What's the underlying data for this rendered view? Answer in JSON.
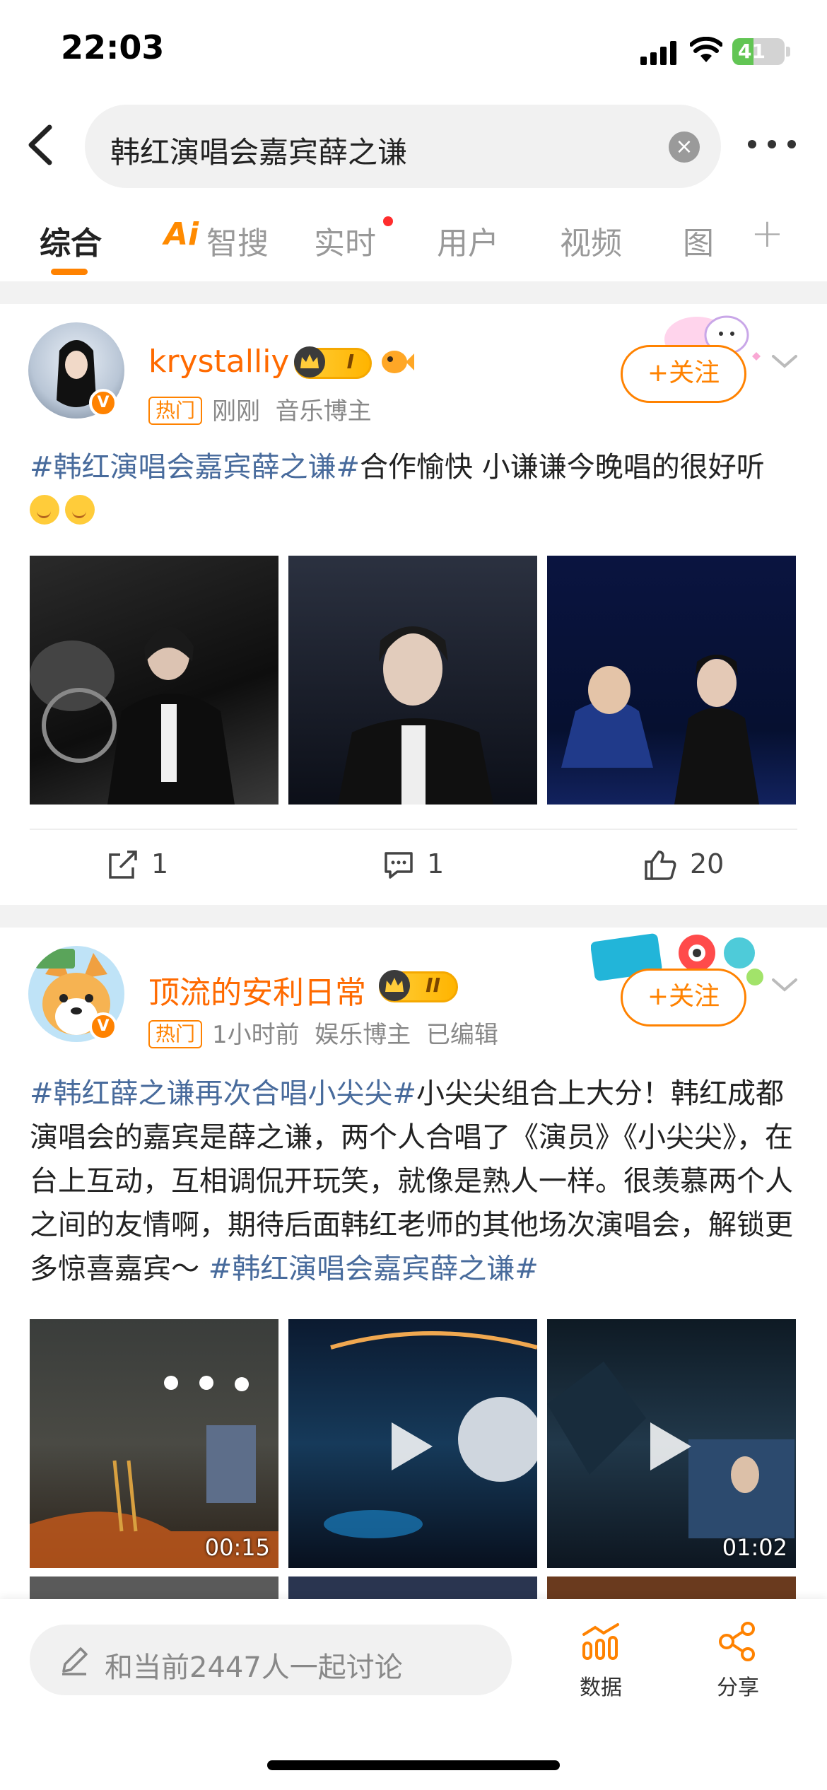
{
  "status_bar": {
    "time": "22:03",
    "battery": "41"
  },
  "search": {
    "query": "韩红演唱会嘉宾薛之谦"
  },
  "tabs": [
    {
      "label": "综合"
    },
    {
      "label": "智搜",
      "prefix": "Ai"
    },
    {
      "label": "实时"
    },
    {
      "label": "用户"
    },
    {
      "label": "视频"
    },
    {
      "label": "图"
    }
  ],
  "posts": [
    {
      "username": "krystalliy",
      "level": "I",
      "hot": "热门",
      "time": "刚刚",
      "category": "音乐博主",
      "follow": "+关注",
      "topic": "#韩红演唱会嘉宾薛之谦#",
      "text": "合作愉快 小谦谦今晚唱的很好听",
      "shares": "1",
      "comments": "1",
      "likes": "20"
    },
    {
      "username": "顶流的安利日常",
      "level": "II",
      "hot": "热门",
      "time": "1小时前",
      "category": "娱乐博主",
      "edited": "已编辑",
      "follow": "+关注",
      "topic": "#韩红薛之谦再次合唱小尖尖#",
      "text": "小尖尖组合上大分！韩红成都演唱会的嘉宾是薛之谦，两个人合唱了《演员》《小尖尖》，在台上互动，互相调侃开玩笑，就像是熟人一样。很羡慕两个人之间的友情啊，期待后面韩红老师的其他场次演唱会，解锁更多惊喜嘉宾～",
      "topic2": "#韩红演唱会嘉宾薛之谦#",
      "durations": [
        "00:15",
        "01:02"
      ]
    }
  ],
  "bottom_bar": {
    "discuss_placeholder": "和当前2447人一起讨论",
    "data_label": "数据",
    "share_label": "分享"
  },
  "colors": {
    "accent": "#ff8200",
    "topic": "#486b9c",
    "active_tab_underline": "#ff8200"
  }
}
